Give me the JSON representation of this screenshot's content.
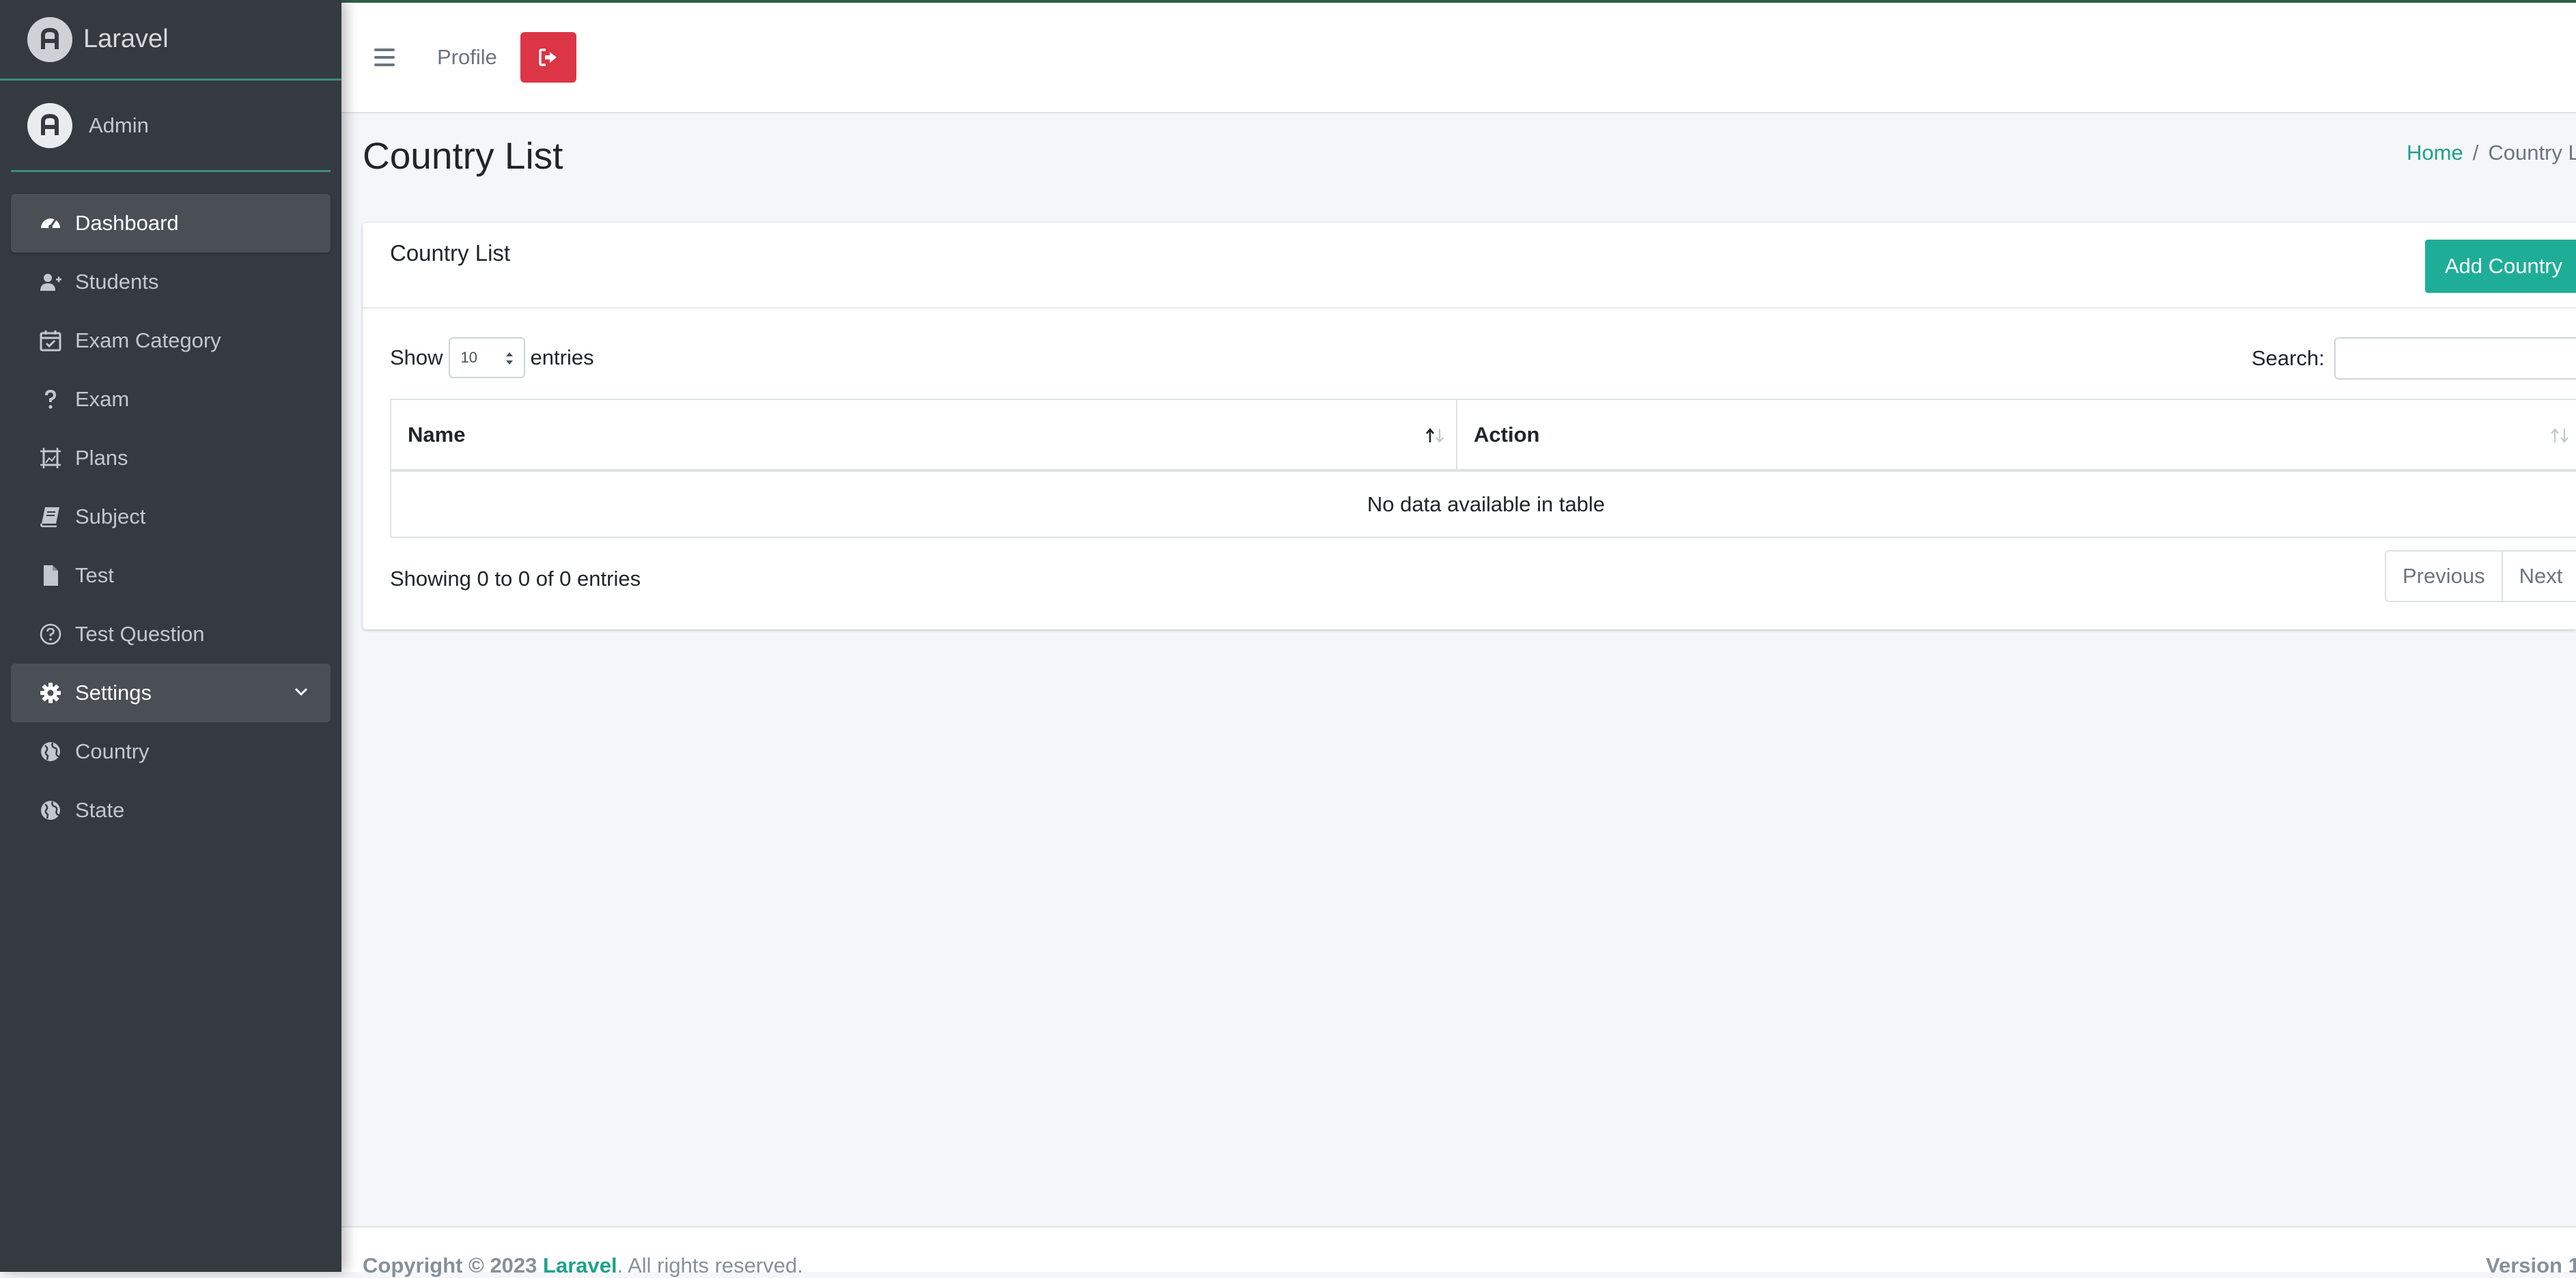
{
  "brand": {
    "name": "Laravel"
  },
  "user": {
    "name": "Admin"
  },
  "sidebar": {
    "items": [
      {
        "label": "Dashboard",
        "icon": "dashboard-icon",
        "active": true
      },
      {
        "label": "Students",
        "icon": "user-plus-icon"
      },
      {
        "label": "Exam Category",
        "icon": "calendar-check-icon"
      },
      {
        "label": "Exam",
        "icon": "question-icon"
      },
      {
        "label": "Plans",
        "icon": "frame-icon"
      },
      {
        "label": "Subject",
        "icon": "book-icon"
      },
      {
        "label": "Test",
        "icon": "file-icon"
      },
      {
        "label": "Test Question",
        "icon": "question-circle-icon"
      },
      {
        "label": "Settings",
        "icon": "gear-icon",
        "expanded": true
      },
      {
        "label": "Country",
        "icon": "globe-icon"
      },
      {
        "label": "State",
        "icon": "globe-icon"
      }
    ]
  },
  "topbar": {
    "profile_label": "Profile",
    "logout_icon": "sign-out-icon"
  },
  "page": {
    "title": "Country List",
    "breadcrumb_home": "Home",
    "breadcrumb_sep": "/",
    "breadcrumb_current": "Country L"
  },
  "card": {
    "title": "Country List",
    "add_button": "Add Country",
    "show_label": "Show",
    "entries_label": "entries",
    "page_length": "10",
    "search_label": "Search:",
    "search_value": "",
    "columns": [
      "Name",
      "Action"
    ],
    "empty_message": "No data available in table",
    "info": "Showing 0 to 0 of 0 entries",
    "prev_label": "Previous",
    "next_label": "Next"
  },
  "footer": {
    "copyright": "Copyright © 2023 ",
    "brand": "Laravel",
    "rights": ". All rights reserved.",
    "version": "Version 1"
  },
  "colors": {
    "sidebar_bg": "#343a40",
    "accent": "#1eae98",
    "danger": "#dc3545",
    "link": "#20a08a"
  }
}
